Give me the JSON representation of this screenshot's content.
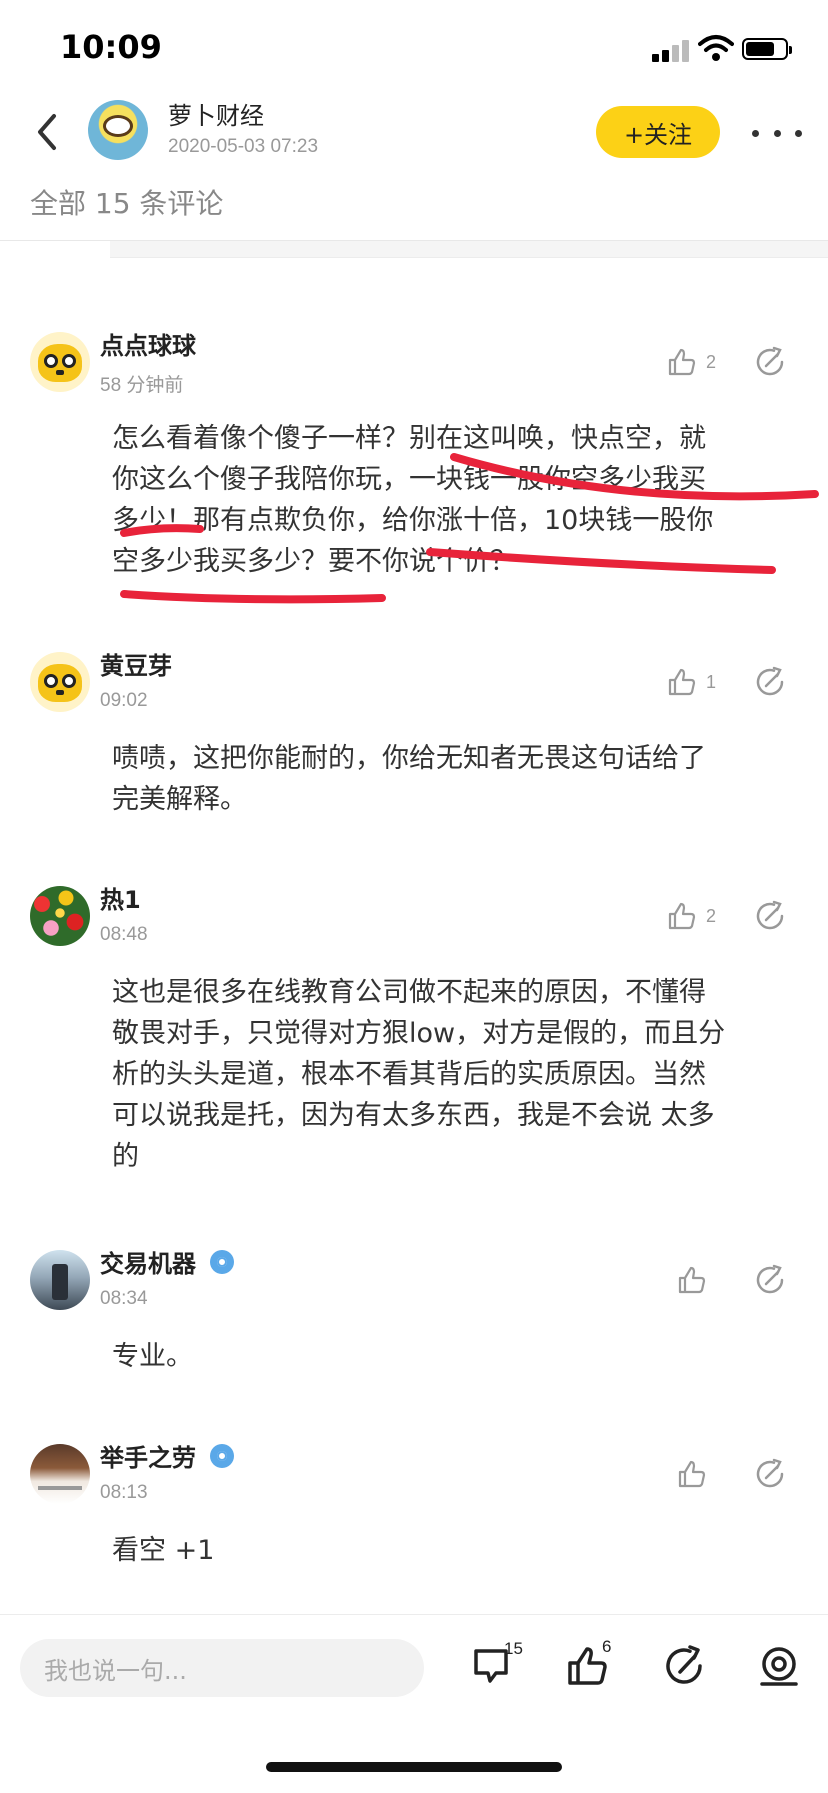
{
  "status_bar": {
    "time": "10:09"
  },
  "header": {
    "author_name": "萝卜财经",
    "post_time": "2020-05-03 07:23",
    "follow_label": "+关注",
    "comment_count_label": "全部 15 条评论"
  },
  "comments": [
    {
      "name": "点点球球",
      "time": "58 分钟前",
      "likes": "2",
      "lines": [
        "怎么看着像个傻子一样？别在这叫唤，快点空，就",
        "你这么个傻子我陪你玩，一块钱一股你空多少我买",
        "多少！那有点欺负你，给你涨十倍，10块钱一股你",
        "空多少我买多少？要不你说个价？"
      ]
    },
    {
      "name": "黄豆芽",
      "time": "09:02",
      "likes": "1",
      "lines": [
        "啧啧，这把你能耐的，你给无知者无畏这句话给了",
        "完美解释。"
      ]
    },
    {
      "name": "热1",
      "time": "08:48",
      "likes": "2",
      "lines": [
        "这也是很多在线教育公司做不起来的原因，不懂得",
        "敬畏对手，只觉得对方狠low，对方是假的，而且分",
        "析的头头是道，根本不看其背后的实质原因。当然",
        "可以说我是托，因为有太多东西，我是不会说 太多",
        "的"
      ]
    },
    {
      "name": "交易机器",
      "time": "08:34",
      "likes": "",
      "lines": [
        "专业。"
      ]
    },
    {
      "name": "举手之劳",
      "time": "08:13",
      "likes": "",
      "lines": [
        "看空 +1"
      ]
    }
  ],
  "bottom_bar": {
    "input_placeholder": "我也说一句...",
    "comment_count": "15",
    "like_count": "6"
  },
  "colors": {
    "accent": "#fcd116",
    "annotation": "#e8233a",
    "muted": "#999999"
  },
  "icons": [
    "back-icon",
    "more-icon",
    "thumb-up-icon",
    "share-icon",
    "comment-icon",
    "verified-icon",
    "signal-icon",
    "wifi-icon",
    "battery-icon"
  ]
}
